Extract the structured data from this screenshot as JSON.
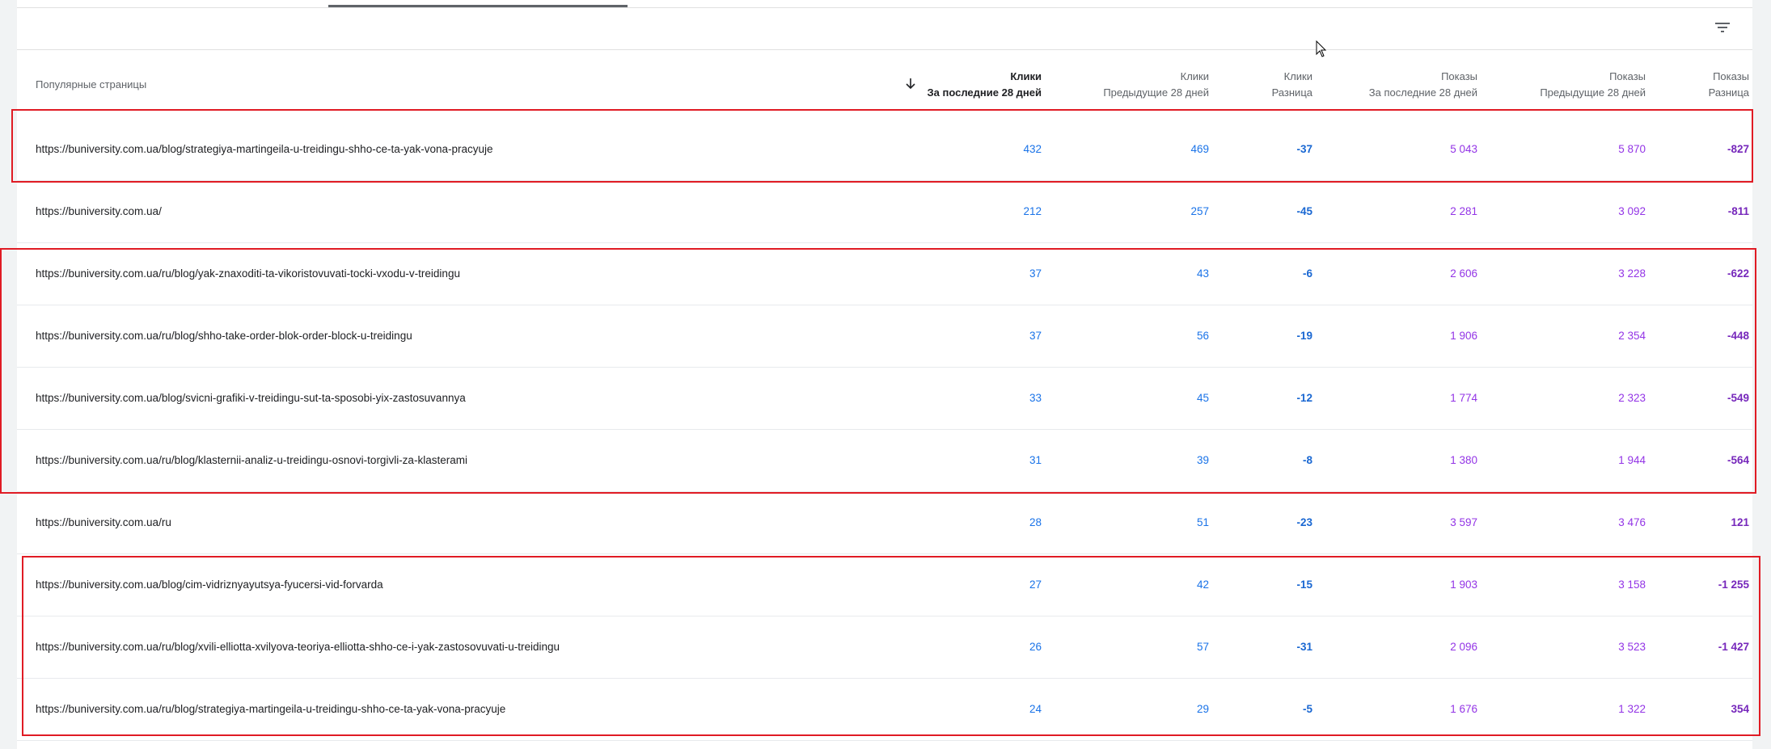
{
  "table": {
    "filter_icon": "filter-list-icon",
    "columns": {
      "pages": "Популярные страницы",
      "clicks_current": [
        "Клики",
        "За последние 28 дней"
      ],
      "clicks_previous": [
        "Клики",
        "Предыдущие 28 дней"
      ],
      "clicks_diff": [
        "Клики",
        "Разница"
      ],
      "impressions_current": [
        "Показы",
        "За последние 28 дней"
      ],
      "impressions_previous": [
        "Показы",
        "Предыдущие 28 дней"
      ],
      "impressions_diff": [
        "Показы",
        "Разница"
      ]
    },
    "sort_icon": "arrow-downward-icon",
    "rows": [
      {
        "url": "https://buniversity.com.ua/blog/strategiya-martingeila-u-treidingu-shho-ce-ta-yak-vona-pracyuje",
        "clicks": "432",
        "clicks_prev": "469",
        "clicks_diff": "-37",
        "imps": "5 043",
        "imps_prev": "5 870",
        "imps_diff": "-827"
      },
      {
        "url": "https://buniversity.com.ua/",
        "clicks": "212",
        "clicks_prev": "257",
        "clicks_diff": "-45",
        "imps": "2 281",
        "imps_prev": "3 092",
        "imps_diff": "-811"
      },
      {
        "url": "https://buniversity.com.ua/ru/blog/yak-znaxoditi-ta-vikoristovuvati-tocki-vxodu-v-treidingu",
        "clicks": "37",
        "clicks_prev": "43",
        "clicks_diff": "-6",
        "imps": "2 606",
        "imps_prev": "3 228",
        "imps_diff": "-622"
      },
      {
        "url": "https://buniversity.com.ua/ru/blog/shho-take-order-blok-order-block-u-treidingu",
        "clicks": "37",
        "clicks_prev": "56",
        "clicks_diff": "-19",
        "imps": "1 906",
        "imps_prev": "2 354",
        "imps_diff": "-448"
      },
      {
        "url": "https://buniversity.com.ua/blog/svicni-grafiki-v-treidingu-sut-ta-sposobi-yix-zastosuvannya",
        "clicks": "33",
        "clicks_prev": "45",
        "clicks_diff": "-12",
        "imps": "1 774",
        "imps_prev": "2 323",
        "imps_diff": "-549"
      },
      {
        "url": "https://buniversity.com.ua/ru/blog/klasternii-analiz-u-treidingu-osnovi-torgivli-za-klasterami",
        "clicks": "31",
        "clicks_prev": "39",
        "clicks_diff": "-8",
        "imps": "1 380",
        "imps_prev": "1 944",
        "imps_diff": "-564"
      },
      {
        "url": "https://buniversity.com.ua/ru",
        "clicks": "28",
        "clicks_prev": "51",
        "clicks_diff": "-23",
        "imps": "3 597",
        "imps_prev": "3 476",
        "imps_diff": "121"
      },
      {
        "url": "https://buniversity.com.ua/blog/cim-vidriznyayutsya-fyucersi-vid-forvarda",
        "clicks": "27",
        "clicks_prev": "42",
        "clicks_diff": "-15",
        "imps": "1 903",
        "imps_prev": "3 158",
        "imps_diff": "-1 255"
      },
      {
        "url": "https://buniversity.com.ua/ru/blog/xvili-elliotta-xvilyova-teoriya-elliotta-shho-ce-i-yak-zastosovuvati-u-treidingu",
        "clicks": "26",
        "clicks_prev": "57",
        "clicks_diff": "-31",
        "imps": "2 096",
        "imps_prev": "3 523",
        "imps_diff": "-1 427"
      },
      {
        "url": "https://buniversity.com.ua/ru/blog/strategiya-martingeila-u-treidingu-shho-ce-ta-yak-vona-pracyuje",
        "clicks": "24",
        "clicks_prev": "29",
        "clicks_diff": "-5",
        "imps": "1 676",
        "imps_prev": "1 322",
        "imps_diff": "354"
      }
    ],
    "colors": {
      "clicks": "#1a73e8",
      "impressions": "#9334e6",
      "highlight_box": "#e01b24"
    }
  }
}
